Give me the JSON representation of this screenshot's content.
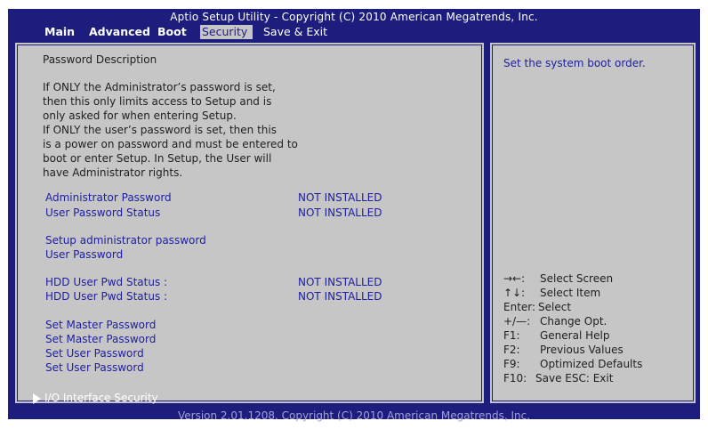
{
  "header": {
    "title": "Aptio Setup Utility - Copyright (C) 2010 American Megatrends, Inc."
  },
  "menu": {
    "items": [
      {
        "label": "Main"
      },
      {
        "label": "Advanced"
      },
      {
        "label": "Boot"
      },
      {
        "label": "Security"
      },
      {
        "label": "Save & Exit"
      }
    ],
    "active": "Security"
  },
  "description": {
    "title": "Password Description",
    "lines": [
      "If ONLY the Administrator’s password is set,",
      "then this only limits access to Setup and is",
      "only asked for when entering Setup.",
      "If ONLY the user’s password is set, then this",
      "is a power on password and must be entered to",
      "boot or enter Setup. In Setup, the User will",
      "have Administrator rights."
    ]
  },
  "items": {
    "admin_password": {
      "label": "Administrator Password",
      "value": "NOT INSTALLED"
    },
    "user_password_status": {
      "label": "User Password Status",
      "value": "NOT INSTALLED"
    },
    "setup_admin_password": {
      "label": "Setup administrator password"
    },
    "user_password": {
      "label": "User Password"
    },
    "hdd_status_1": {
      "label": "HDD User Pwd Status :",
      "value": "NOT INSTALLED"
    },
    "hdd_status_2": {
      "label": "HDD User Pwd Status :",
      "value": "NOT INSTALLED"
    },
    "set_master_1": {
      "label": "Set Master Password"
    },
    "set_master_2": {
      "label": "Set Master Password"
    },
    "set_user_1": {
      "label": "Set User Password"
    },
    "set_user_2": {
      "label": "Set User Password"
    },
    "io_security": {
      "label": "I/O Interface Security"
    }
  },
  "help": {
    "text": "Set the system boot order."
  },
  "keys": [
    {
      "key": "→←:",
      "desc": "Select Screen"
    },
    {
      "key": "↑↓:",
      "desc": "Select Item"
    },
    {
      "key": "Enter:",
      "desc": "Select"
    },
    {
      "key": "+/—:",
      "desc": "Change Opt."
    },
    {
      "key": "F1:",
      "desc": "General Help"
    },
    {
      "key": "F2:",
      "desc": "Previous Values"
    },
    {
      "key": "F9:",
      "desc": "Optimized Defaults"
    },
    {
      "key": "F10:",
      "desc": "Save   ESC: Exit"
    }
  ],
  "footer": {
    "text": "Version 2.01.1208. Copyright (C) 2010 American Megatrends, Inc."
  },
  "colors": {
    "frame_blue": "#1d1d7e",
    "panel_gray": "#c6c6c6",
    "item_blue": "#2020a0",
    "text_dark": "#1f1f1f",
    "highlight_white": "#ffffff"
  }
}
